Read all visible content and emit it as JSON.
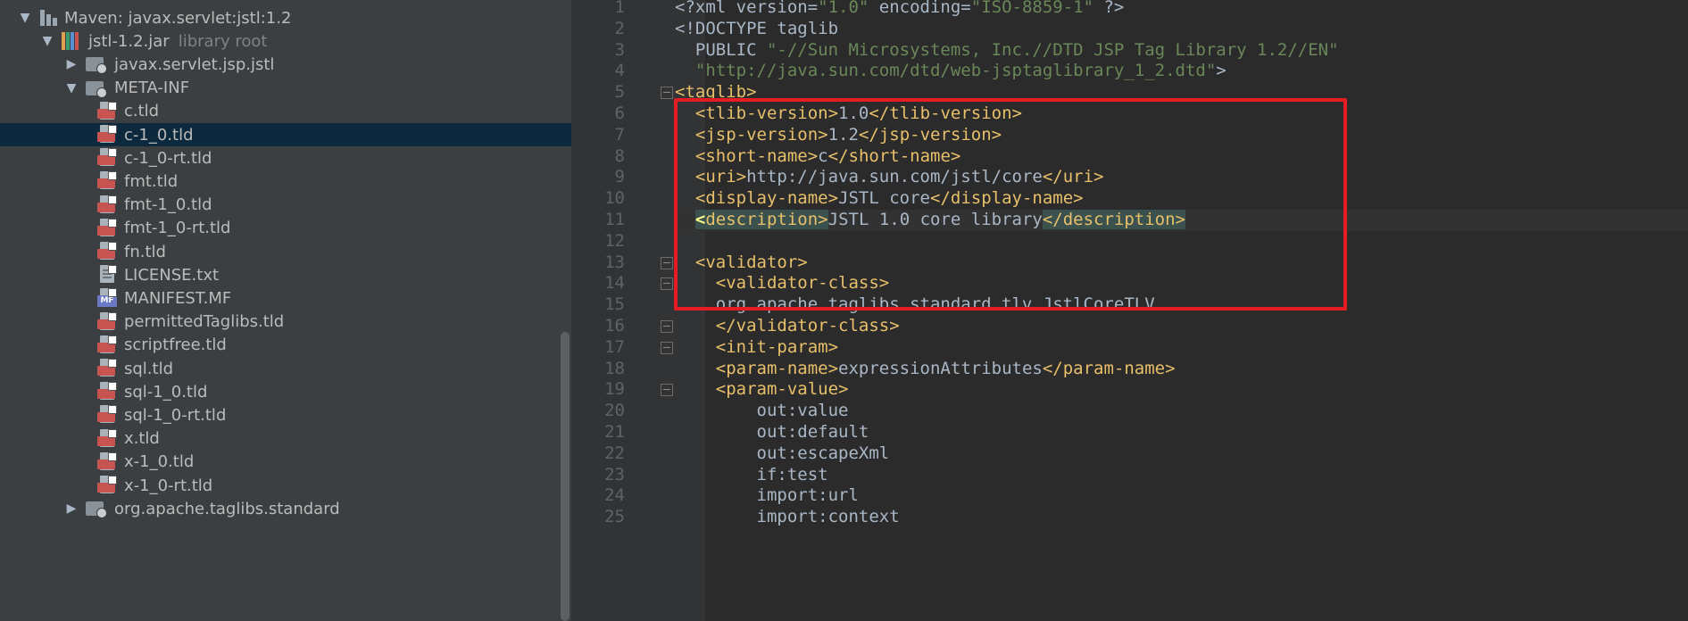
{
  "project_tree": {
    "rows": [
      {
        "label": "Maven: javax.servlet:jstl:1.2",
        "secondary": "",
        "arrow": "▼",
        "icon": "module-icon",
        "level": 1
      },
      {
        "label": "jstl-1.2.jar",
        "secondary": "library root",
        "arrow": "▼",
        "icon": "jar-icon",
        "level": 2
      },
      {
        "label": "javax.servlet.jsp.jstl",
        "secondary": "",
        "arrow": "▶",
        "icon": "package-icon",
        "level": 3
      },
      {
        "label": "META-INF",
        "secondary": "",
        "arrow": "▼",
        "icon": "package-icon",
        "level": 3
      },
      {
        "label": "c.tld",
        "secondary": "",
        "arrow": "",
        "icon": "tld-file-icon",
        "level": 4
      },
      {
        "label": "c-1_0.tld",
        "secondary": "",
        "arrow": "",
        "icon": "tld-file-icon",
        "level": 4,
        "selected": true
      },
      {
        "label": "c-1_0-rt.tld",
        "secondary": "",
        "arrow": "",
        "icon": "tld-file-icon",
        "level": 4
      },
      {
        "label": "fmt.tld",
        "secondary": "",
        "arrow": "",
        "icon": "tld-file-icon",
        "level": 4
      },
      {
        "label": "fmt-1_0.tld",
        "secondary": "",
        "arrow": "",
        "icon": "tld-file-icon",
        "level": 4
      },
      {
        "label": "fmt-1_0-rt.tld",
        "secondary": "",
        "arrow": "",
        "icon": "tld-file-icon",
        "level": 4
      },
      {
        "label": "fn.tld",
        "secondary": "",
        "arrow": "",
        "icon": "tld-file-icon",
        "level": 4
      },
      {
        "label": "LICENSE.txt",
        "secondary": "",
        "arrow": "",
        "icon": "text-file-icon",
        "level": 4
      },
      {
        "label": "MANIFEST.MF",
        "secondary": "",
        "arrow": "",
        "icon": "manifest-file-icon",
        "level": 4
      },
      {
        "label": "permittedTaglibs.tld",
        "secondary": "",
        "arrow": "",
        "icon": "tld-file-icon",
        "level": 4
      },
      {
        "label": "scriptfree.tld",
        "secondary": "",
        "arrow": "",
        "icon": "tld-file-icon",
        "level": 4
      },
      {
        "label": "sql.tld",
        "secondary": "",
        "arrow": "",
        "icon": "tld-file-icon",
        "level": 4
      },
      {
        "label": "sql-1_0.tld",
        "secondary": "",
        "arrow": "",
        "icon": "tld-file-icon",
        "level": 4
      },
      {
        "label": "sql-1_0-rt.tld",
        "secondary": "",
        "arrow": "",
        "icon": "tld-file-icon",
        "level": 4
      },
      {
        "label": "x.tld",
        "secondary": "",
        "arrow": "",
        "icon": "tld-file-icon",
        "level": 4
      },
      {
        "label": "x-1_0.tld",
        "secondary": "",
        "arrow": "",
        "icon": "tld-file-icon",
        "level": 4
      },
      {
        "label": "x-1_0-rt.tld",
        "secondary": "",
        "arrow": "",
        "icon": "tld-file-icon",
        "level": 4
      },
      {
        "label": "org.apache.taglibs.standard",
        "secondary": "",
        "arrow": "▶",
        "icon": "package-icon",
        "level": 3
      }
    ]
  },
  "editor": {
    "current_line": 11,
    "fold_markers": [
      5,
      13,
      14,
      16,
      17,
      19
    ],
    "lines": [
      {
        "n": "1",
        "tokens": [
          {
            "t": "<?xml version=",
            "c": "tx"
          },
          {
            "t": "\"1.0\"",
            "c": "st"
          },
          {
            "t": " encoding=",
            "c": "tx"
          },
          {
            "t": "\"ISO-8859-1\"",
            "c": "st"
          },
          {
            "t": " ?>",
            "c": "tx"
          }
        ]
      },
      {
        "n": "2",
        "tokens": [
          {
            "t": "<!DOCTYPE taglib",
            "c": "tx"
          }
        ]
      },
      {
        "n": "3",
        "tokens": [
          {
            "t": "  PUBLIC ",
            "c": "tx"
          },
          {
            "t": "\"-//Sun Microsystems, Inc.//DTD JSP Tag Library 1.2//EN\"",
            "c": "st"
          }
        ]
      },
      {
        "n": "4",
        "tokens": [
          {
            "t": "  ",
            "c": "tx"
          },
          {
            "t": "\"http://java.sun.com/dtd/web-jsptaglibrary_1_2.dtd\"",
            "c": "st"
          },
          {
            "t": ">",
            "c": "tx"
          }
        ]
      },
      {
        "n": "5",
        "tokens": [
          {
            "t": "<taglib>",
            "c": "tg"
          }
        ]
      },
      {
        "n": "6",
        "tokens": [
          {
            "t": "  ",
            "c": "tx"
          },
          {
            "t": "<tlib-version>",
            "c": "tg"
          },
          {
            "t": "1.0",
            "c": "tx"
          },
          {
            "t": "</tlib-version>",
            "c": "tg"
          }
        ]
      },
      {
        "n": "7",
        "tokens": [
          {
            "t": "  ",
            "c": "tx"
          },
          {
            "t": "<jsp-version>",
            "c": "tg"
          },
          {
            "t": "1.2",
            "c": "tx"
          },
          {
            "t": "</jsp-version>",
            "c": "tg"
          }
        ]
      },
      {
        "n": "8",
        "tokens": [
          {
            "t": "  ",
            "c": "tx"
          },
          {
            "t": "<short-name>",
            "c": "tg"
          },
          {
            "t": "c",
            "c": "tx"
          },
          {
            "t": "</short-name>",
            "c": "tg"
          }
        ]
      },
      {
        "n": "9",
        "tokens": [
          {
            "t": "  ",
            "c": "tx"
          },
          {
            "t": "<uri>",
            "c": "tg"
          },
          {
            "t": "http://java.sun.com/jstl/core",
            "c": "tx"
          },
          {
            "t": "</uri>",
            "c": "tg"
          }
        ]
      },
      {
        "n": "10",
        "tokens": [
          {
            "t": "  ",
            "c": "tx"
          },
          {
            "t": "<display-name>",
            "c": "tg"
          },
          {
            "t": "JSTL core",
            "c": "tx"
          },
          {
            "t": "</display-name>",
            "c": "tg"
          }
        ]
      },
      {
        "n": "11",
        "tokens": [
          {
            "t": "  ",
            "c": "tx"
          },
          {
            "t": "<",
            "c": "tg hl-strong"
          },
          {
            "t": "description>",
            "c": "tg hl"
          },
          {
            "t": "JSTL 1.0 core library",
            "c": "tx"
          },
          {
            "t": "</description>",
            "c": "tg hl"
          }
        ]
      },
      {
        "n": "12",
        "tokens": []
      },
      {
        "n": "13",
        "tokens": [
          {
            "t": "  ",
            "c": "tx"
          },
          {
            "t": "<validator>",
            "c": "tg"
          }
        ]
      },
      {
        "n": "14",
        "tokens": [
          {
            "t": "    ",
            "c": "tx"
          },
          {
            "t": "<validator-class>",
            "c": "tg"
          }
        ]
      },
      {
        "n": "15",
        "tokens": [
          {
            "t": "    org.apache.taglibs.standard.tlv.JstlCoreTLV",
            "c": "tx"
          }
        ]
      },
      {
        "n": "16",
        "tokens": [
          {
            "t": "    ",
            "c": "tx"
          },
          {
            "t": "</validator-class>",
            "c": "tg"
          }
        ]
      },
      {
        "n": "17",
        "tokens": [
          {
            "t": "    ",
            "c": "tx"
          },
          {
            "t": "<init-param>",
            "c": "tg"
          }
        ]
      },
      {
        "n": "18",
        "tokens": [
          {
            "t": "    ",
            "c": "tx"
          },
          {
            "t": "<param-name>",
            "c": "tg"
          },
          {
            "t": "expressionAttributes",
            "c": "tx"
          },
          {
            "t": "</param-name>",
            "c": "tg"
          }
        ]
      },
      {
        "n": "19",
        "tokens": [
          {
            "t": "    ",
            "c": "tx"
          },
          {
            "t": "<param-value>",
            "c": "tg"
          }
        ]
      },
      {
        "n": "20",
        "tokens": [
          {
            "t": "        out:value",
            "c": "tx"
          }
        ]
      },
      {
        "n": "21",
        "tokens": [
          {
            "t": "        out:default",
            "c": "tx"
          }
        ]
      },
      {
        "n": "22",
        "tokens": [
          {
            "t": "        out:escapeXml",
            "c": "tx"
          }
        ]
      },
      {
        "n": "23",
        "tokens": [
          {
            "t": "        if:test",
            "c": "tx"
          }
        ]
      },
      {
        "n": "24",
        "tokens": [
          {
            "t": "        import:url",
            "c": "tx"
          }
        ]
      },
      {
        "n": "25",
        "tokens": [
          {
            "t": "        import:context",
            "c": "tx"
          }
        ]
      }
    ]
  },
  "annotation": {
    "color": "#e51c23"
  }
}
